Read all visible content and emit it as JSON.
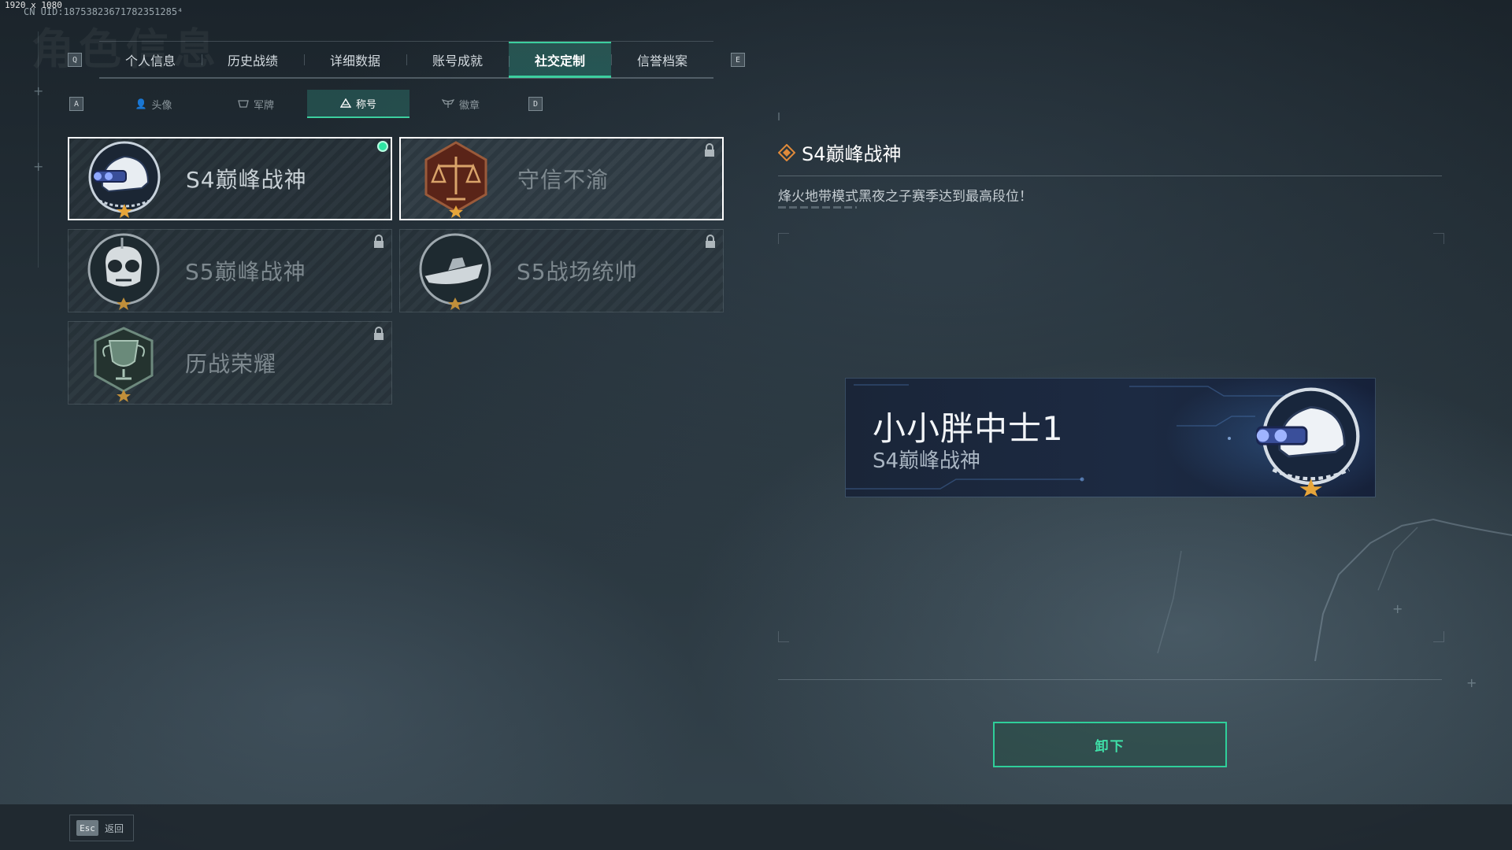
{
  "debug": {
    "resolution": "1920 x 1080",
    "uid": "CN UID:18753823671782351285⁴"
  },
  "header": {
    "ghost_title": "角色信息"
  },
  "main_tabs": {
    "prev_key": "Q",
    "next_key": "E",
    "items": [
      {
        "label": "个人信息"
      },
      {
        "label": "历史战绩"
      },
      {
        "label": "详细数据"
      },
      {
        "label": "账号成就"
      },
      {
        "label": "社交定制",
        "active": true
      },
      {
        "label": "信誉档案"
      }
    ]
  },
  "sub_tabs": {
    "prev_key": "A",
    "next_key": "D",
    "items": [
      {
        "label": "头像",
        "icon": "person-icon"
      },
      {
        "label": "军牌",
        "icon": "dogtag-icon"
      },
      {
        "label": "称号",
        "icon": "triangle-icon",
        "active": true
      },
      {
        "label": "徽章",
        "icon": "wings-icon"
      }
    ]
  },
  "titles": [
    {
      "label": "S4巅峰战神",
      "emblem": "helmet-nightvision-emblem",
      "equipped": true,
      "locked": false
    },
    {
      "label": "守信不渝",
      "emblem": "scales-emblem",
      "equipped": false,
      "locked": true,
      "selected": true
    },
    {
      "label": "S5巅峰战神",
      "emblem": "skull-mask-emblem",
      "equipped": false,
      "locked": true
    },
    {
      "label": "S5战场统帅",
      "emblem": "warship-emblem",
      "equipped": false,
      "locked": true
    },
    {
      "label": "历战荣耀",
      "emblem": "trophy-emblem",
      "equipped": false,
      "locked": true
    }
  ],
  "detail": {
    "title": "S4巅峰战神",
    "description": "烽火地带模式黑夜之子赛季达到最高段位！"
  },
  "nameplate": {
    "player_name": "小小胖中士1",
    "title": "S4巅峰战神"
  },
  "actions": {
    "unequip_label": "卸下"
  },
  "footer": {
    "esc_key": "Esc",
    "back_label": "返回"
  },
  "colors": {
    "accent": "#3ccf9f",
    "equipped_dot": "#2ee6a3",
    "gold_star": "#e6a53a"
  }
}
